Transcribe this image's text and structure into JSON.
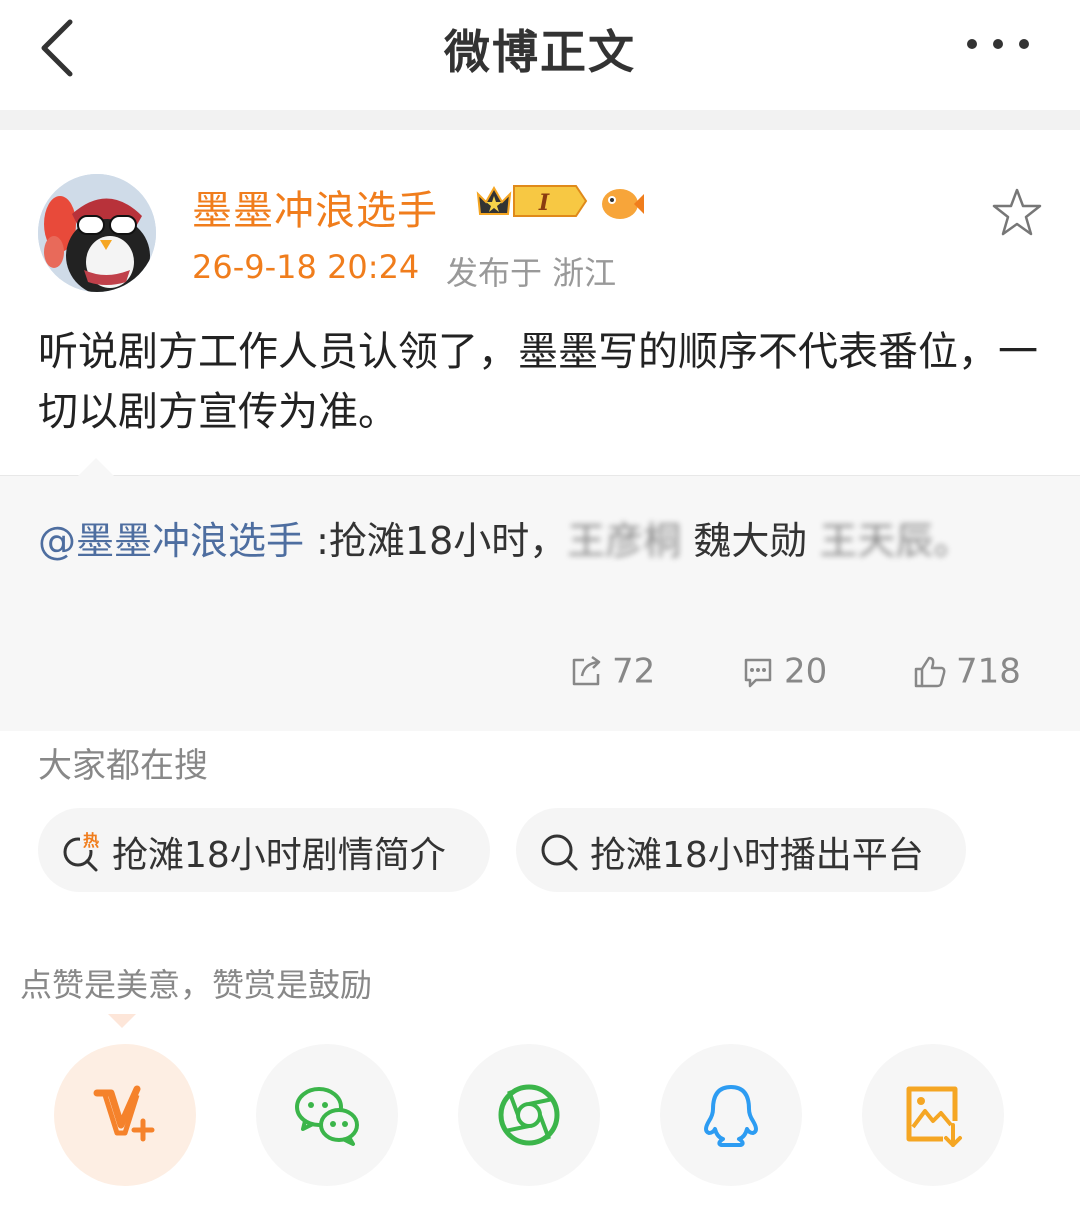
{
  "header": {
    "title": "微博正文"
  },
  "post": {
    "username": "墨墨冲浪选手",
    "timestamp": "26-9-18 20:24",
    "source": "发布于 浙江",
    "text": "听说剧方工作人员认领了，墨墨写的顺序不代表番位，一切以剧方宣传为准。",
    "badge_label": "I"
  },
  "repost": {
    "mention": "@墨墨冲浪选手",
    "text_visible": " :抢滩18小时，",
    "text_blurred_1": "王彦桐",
    "text_middle": " 魏大勋 ",
    "text_blurred_2": "王天辰。",
    "stats": {
      "reposts": "72",
      "comments": "20",
      "likes": "718"
    }
  },
  "search": {
    "heading": "大家都在搜",
    "hot_tag": "热",
    "items": [
      {
        "label": "抢滩18小时剧情简介",
        "icon": "hot-search-icon"
      },
      {
        "label": "抢滩18小时播出平台",
        "icon": "search-icon"
      }
    ]
  },
  "share": {
    "heading": "点赞是美意，赞赏是鼓励",
    "buttons": [
      {
        "icon": "vplus-icon",
        "color": "#f5822b"
      },
      {
        "icon": "wechat-icon",
        "color": "#3bb54a"
      },
      {
        "icon": "moments-icon",
        "color": "#3bb54a"
      },
      {
        "icon": "qq-icon",
        "color": "#2d9cf2"
      },
      {
        "icon": "save-image-icon",
        "color": "#f5a623"
      }
    ]
  },
  "colors": {
    "accent": "#f07d1c",
    "mention": "#4e6ea0",
    "muted": "#999999"
  }
}
